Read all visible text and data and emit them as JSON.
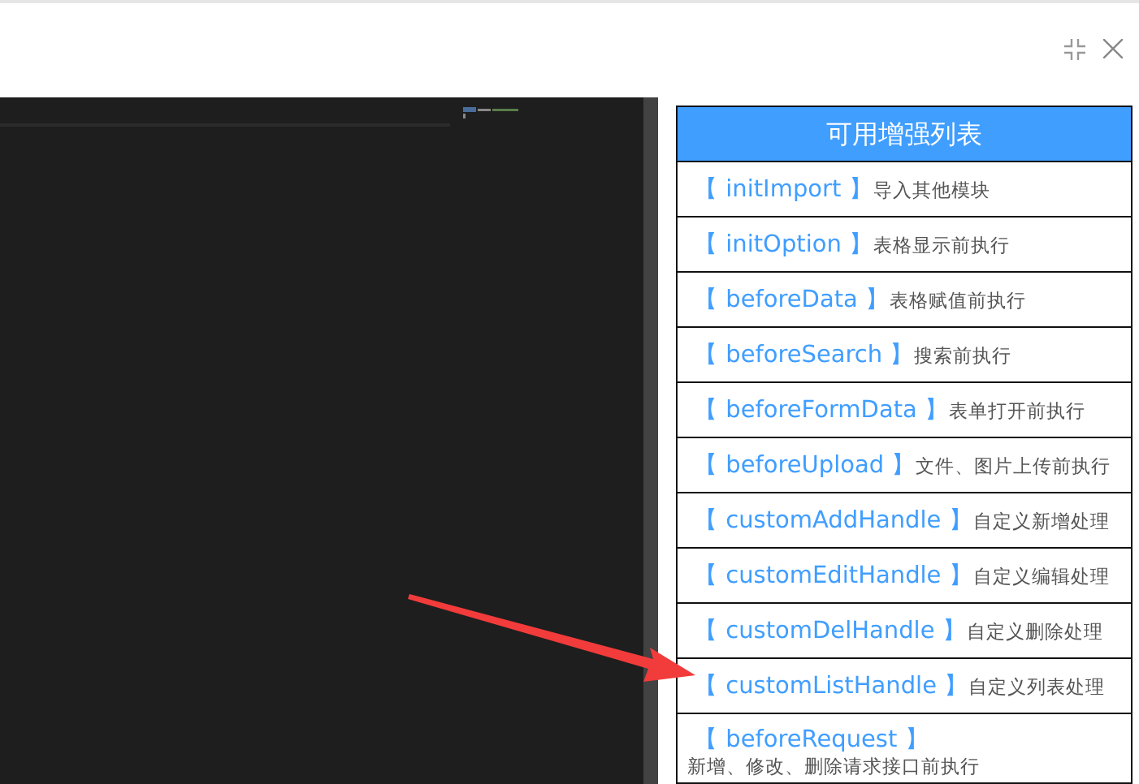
{
  "window": {
    "controls": [
      {
        "kind": "restore"
      },
      {
        "kind": "close"
      }
    ]
  },
  "enhancements": {
    "title": "可用增强列表",
    "items": [
      {
        "name": "【 initImport 】",
        "description": "导入其他模块"
      },
      {
        "name": "【 initOption 】",
        "description": "表格显示前执行"
      },
      {
        "name": "【 beforeData 】",
        "description": "表格赋值前执行"
      },
      {
        "name": "【 beforeSearch 】",
        "description": "搜索前执行"
      },
      {
        "name": "【 beforeFormData 】",
        "description": "表单打开前执行"
      },
      {
        "name": "【 beforeUpload 】",
        "description": "文件、图片上传前执行"
      },
      {
        "name": "【 customAddHandle 】",
        "description": "自定义新增处理"
      },
      {
        "name": "【 customEditHandle 】",
        "description": "自定义编辑处理"
      },
      {
        "name": "【 customDelHandle 】",
        "description": "自定义删除处理"
      },
      {
        "name": "【 customListHandle 】",
        "description": "自定义列表处理"
      },
      {
        "name": "【 beforeRequest 】",
        "description": "新增、修改、删除请求接口前执行"
      }
    ]
  }
}
